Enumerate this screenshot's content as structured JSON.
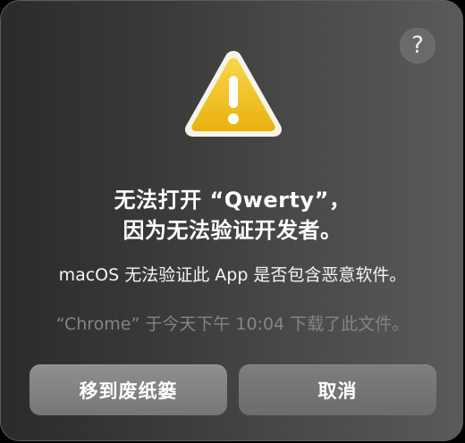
{
  "dialog": {
    "icon": "warning-triangle-icon",
    "help_label": "?",
    "title_line1": "无法打开 “Qwerty”，",
    "title_line2": "因为无法验证开发者。",
    "message": "macOS 无法验证此 App 是否包含恶意软件。",
    "info": "“Chrome” 于今天下午 10:04 下载了此文件。",
    "buttons": {
      "move_to_trash": "移到废纸篓",
      "cancel": "取消"
    },
    "colors": {
      "warning_fill": "#f2c21b",
      "warning_border": "#f7f4e8",
      "exclamation": "#ffffff"
    }
  }
}
